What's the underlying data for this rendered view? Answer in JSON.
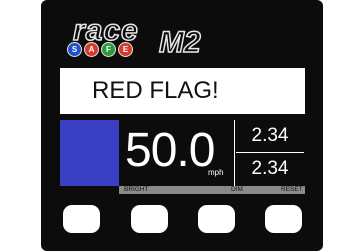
{
  "logo": {
    "brand": "race",
    "safe_letters": [
      "S",
      "A",
      "F",
      "E"
    ],
    "product": "M2"
  },
  "colors": {
    "flag_block": "#3a3fc4",
    "background": "#0c0c0c",
    "safe_dots": [
      "#2250c8",
      "#d63a2a",
      "#2e9b3a",
      "#d63a2a"
    ]
  },
  "banner": {
    "text": "RED FLAG!"
  },
  "readout": {
    "speed": "50.0",
    "unit": "mph"
  },
  "side_values": {
    "top": "2.34",
    "bottom": "2.34"
  },
  "labels": {
    "bright": "BRIGHT",
    "dim": "DIM",
    "reset": "RESET"
  }
}
